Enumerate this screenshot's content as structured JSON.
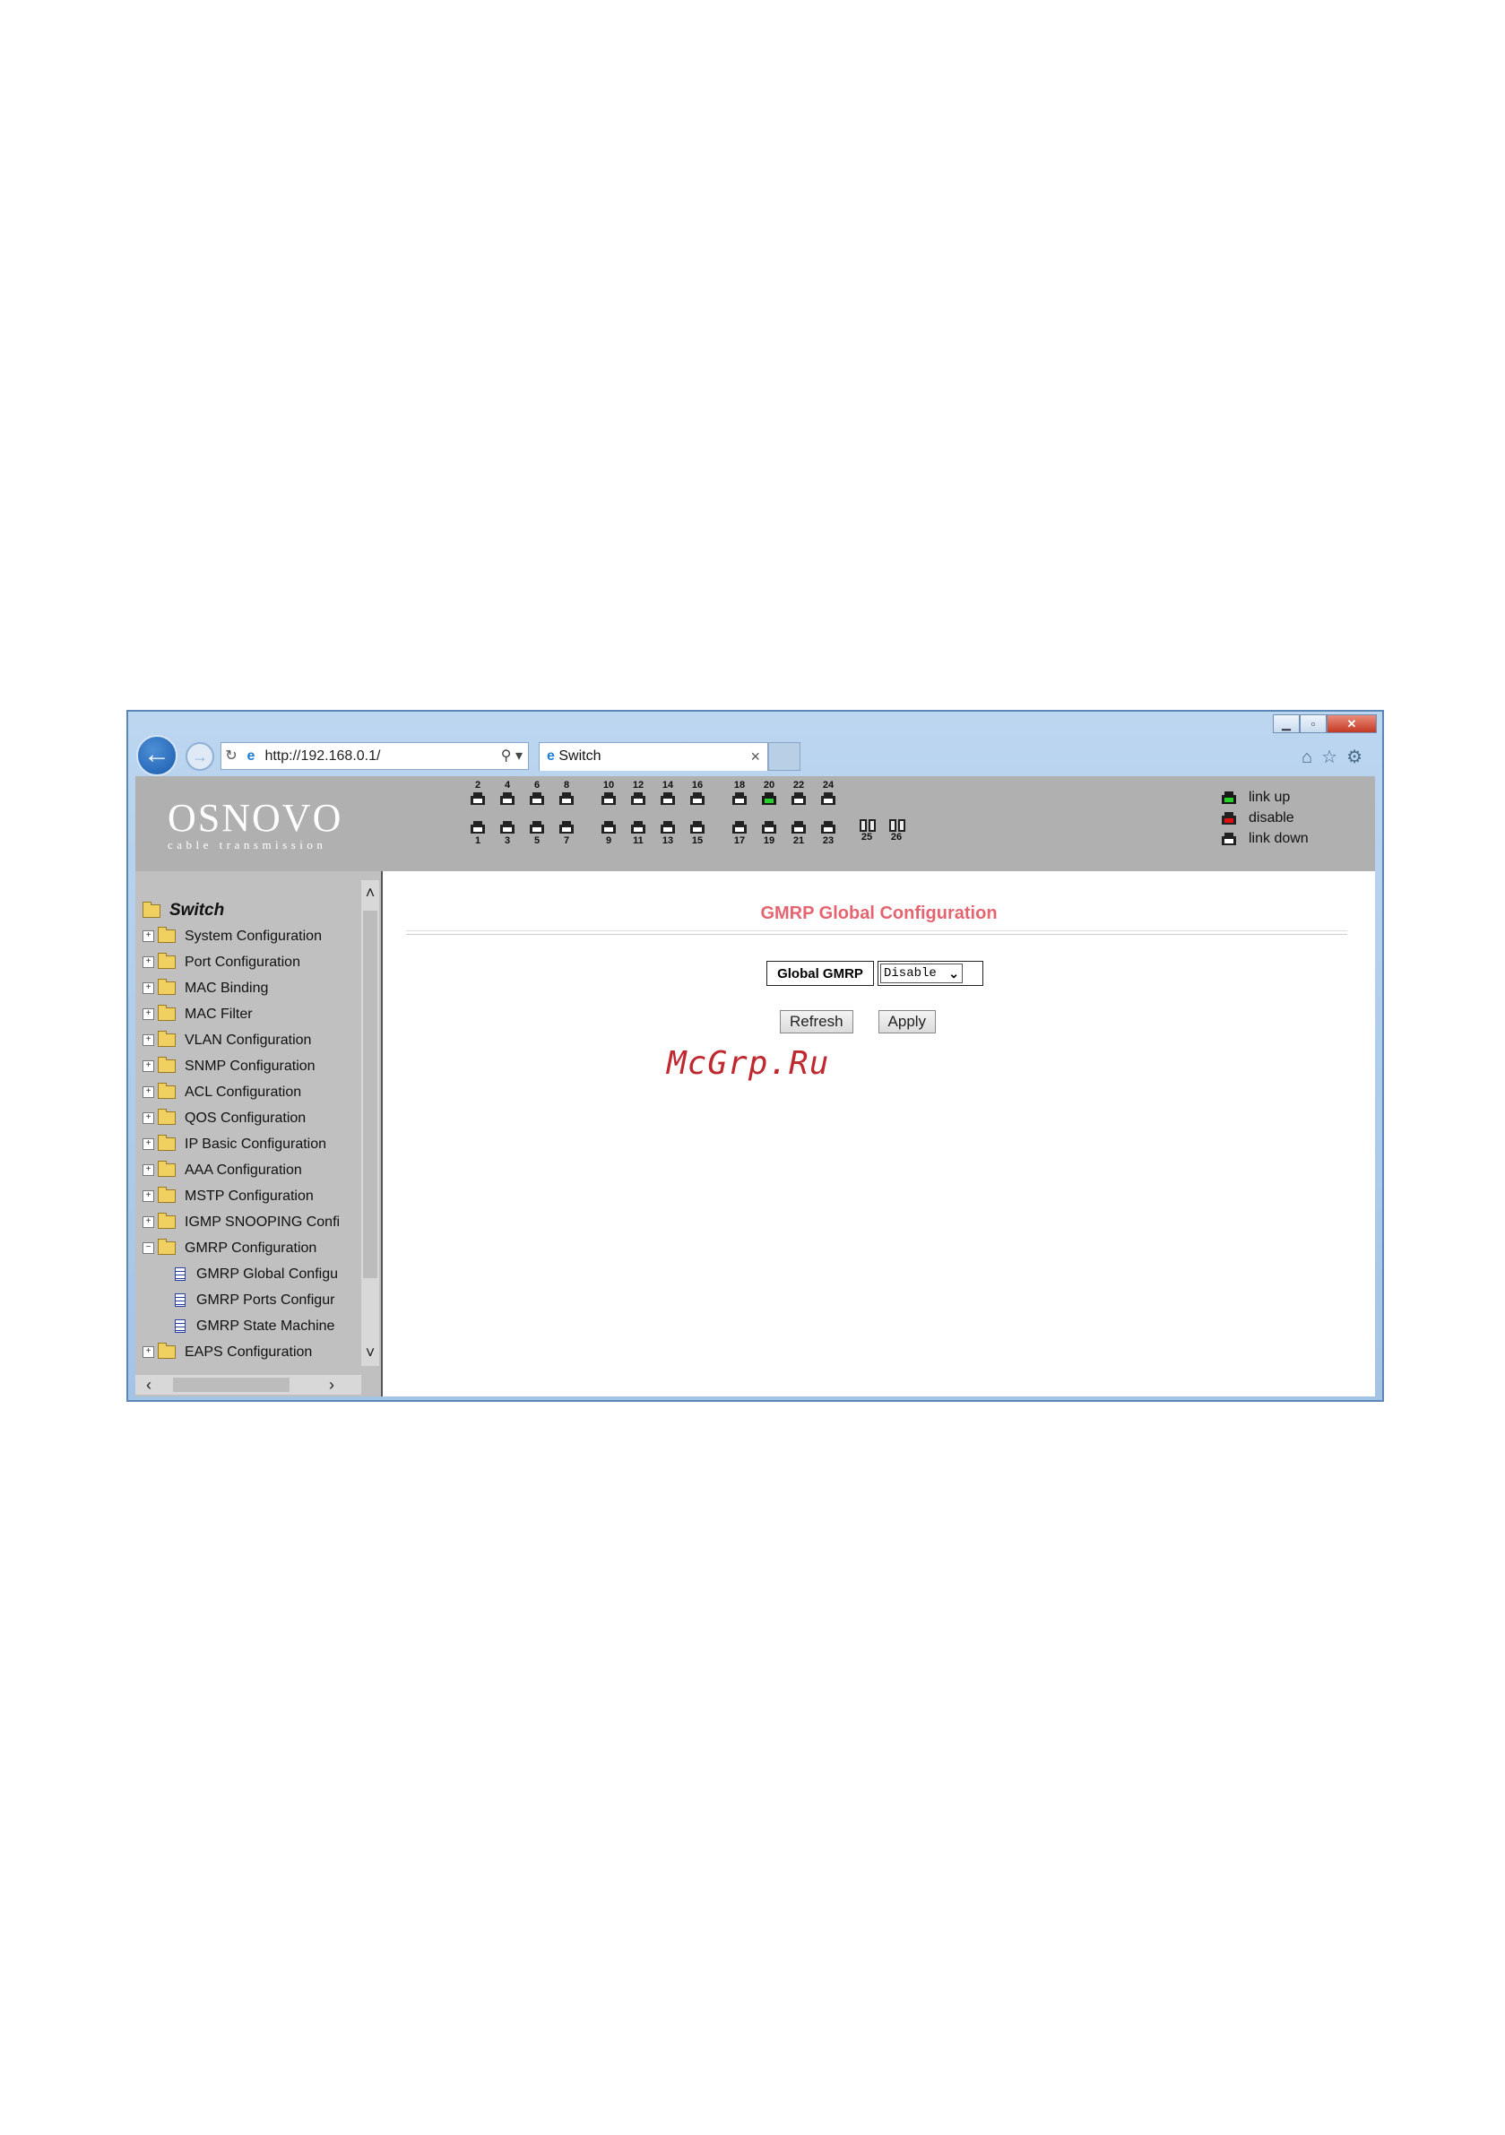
{
  "browser": {
    "address": "http://192.168.0.1/",
    "tab_title": "Switch",
    "caption_close": "✕"
  },
  "header": {
    "logo_main": "OSNOVO",
    "logo_sub": "cable transmission",
    "ports_top": [
      "2",
      "4",
      "6",
      "8",
      "10",
      "12",
      "14",
      "16",
      "18",
      "20",
      "22",
      "24"
    ],
    "ports_bottom": [
      "1",
      "3",
      "5",
      "7",
      "9",
      "11",
      "13",
      "15",
      "17",
      "19",
      "21",
      "23"
    ],
    "sfp_ports": [
      "25",
      "26"
    ],
    "link_up_port": "20",
    "legend": {
      "up": "link up",
      "disable": "disable",
      "down": "link down"
    },
    "colors": {
      "link_up": "#28d12a",
      "disable": "#e01010"
    }
  },
  "tree": {
    "root": "Switch",
    "items": [
      "System Configuration",
      "Port Configuration",
      "MAC Binding",
      "MAC Filter",
      "VLAN Configuration",
      "SNMP Configuration",
      "ACL Configuration",
      "QOS Configuration",
      "IP Basic Configuration",
      "AAA Configuration",
      "MSTP Configuration",
      "IGMP SNOOPING Confi",
      "GMRP Configuration"
    ],
    "children": [
      "GMRP Global Configu",
      "GMRP Ports Configur",
      "GMRP State Machine"
    ],
    "last": "EAPS Configuration"
  },
  "content": {
    "title": "GMRP Global Configuration",
    "field_label": "Global GMRP",
    "field_value": "Disable",
    "refresh": "Refresh",
    "apply": "Apply",
    "title_color": "#e46470"
  },
  "watermark": "McGrp.Ru"
}
